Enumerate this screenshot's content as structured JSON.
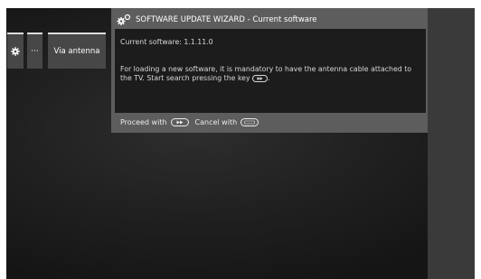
{
  "menu": {
    "gear_icon": "gear-icon",
    "dots_label": "···",
    "via_antenna_label": "Via antenna"
  },
  "wizard": {
    "title": "SOFTWARE UPDATE WIZARD - Current software",
    "current_software": "Current software: 1.1.11.0",
    "message": "For loading a new software, it is mandatory to have the antenna cable attached to the TV. Start search pressing the key",
    "message_end": ".",
    "proceed_label": "Proceed with",
    "cancel_label": "Cancel with",
    "proceed_key": "forward-key-icon",
    "cancel_key": "back-key-icon"
  },
  "colors": {
    "background": "#222222",
    "panel": "#5d5d5d",
    "content": "#1c1c1c",
    "menu_item": "#474747",
    "text": "#ffffff"
  }
}
